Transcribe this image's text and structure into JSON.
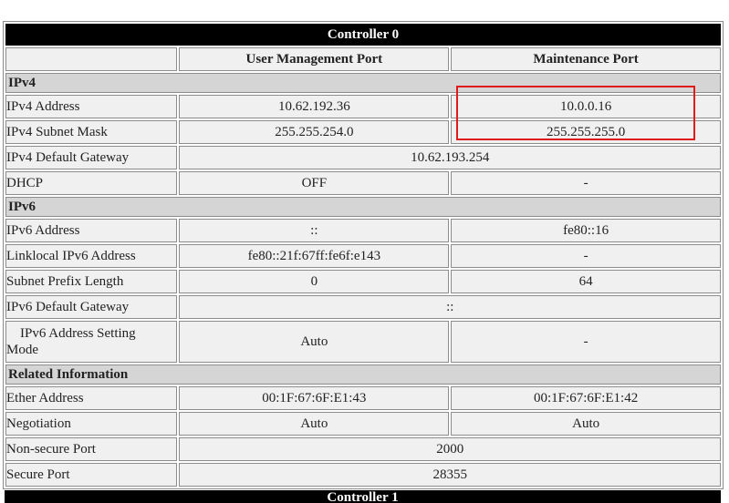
{
  "controller_title": "Controller 0",
  "columns": {
    "user_port": "User Management Port",
    "maint_port": "Maintenance Port"
  },
  "ipv4": {
    "section": "IPv4",
    "address": {
      "label": "IPv4 Address",
      "user": "10.62.192.36",
      "maint": "10.0.0.16"
    },
    "subnet": {
      "label": "IPv4 Subnet Mask",
      "user": "255.255.254.0",
      "maint": "255.255.255.0"
    },
    "gateway": {
      "label": "IPv4 Default Gateway",
      "value": "10.62.193.254"
    },
    "dhcp": {
      "label": "DHCP",
      "user": "OFF",
      "maint": "-"
    }
  },
  "ipv6": {
    "section": "IPv6",
    "address": {
      "label": "IPv6 Address",
      "user": "::",
      "maint": "fe80::16"
    },
    "linklocal": {
      "label": "Linklocal IPv6 Address",
      "user": "fe80::21f:67ff:fe6f:e143",
      "maint": "-"
    },
    "prefix": {
      "label": "Subnet Prefix Length",
      "user": "0",
      "maint": "64"
    },
    "gateway": {
      "label": "IPv6 Default Gateway",
      "value": "::"
    },
    "mode": {
      "label_line1": "IPv6 Address Setting",
      "label_line2": "Mode",
      "user": "Auto",
      "maint": "-"
    }
  },
  "related": {
    "section": "Related Information",
    "ether": {
      "label": "Ether Address",
      "user": "00:1F:67:6F:E1:43",
      "maint": "00:1F:67:6F:E1:42"
    },
    "negotiation": {
      "label": "Negotiation",
      "user": "Auto",
      "maint": "Auto"
    },
    "nonsecure": {
      "label": "Non-secure Port",
      "value": "2000"
    },
    "secure": {
      "label": "Secure Port",
      "value": "28355"
    }
  },
  "next_controller_title": "Controller 1",
  "highlight_color": "#e11a1a"
}
